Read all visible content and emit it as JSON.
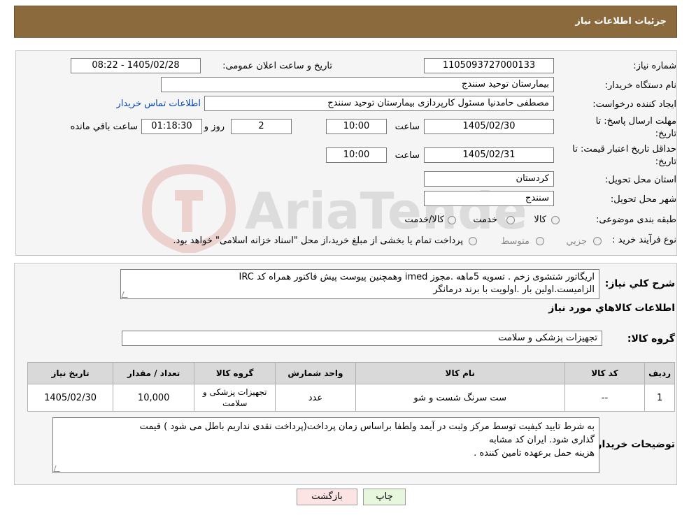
{
  "header": {
    "title": "جزئیات اطلاعات نیاز"
  },
  "form": {
    "need_number_label": "شماره نیاز:",
    "need_number": "1105093727000133",
    "announce_label": "تاریخ و ساعت اعلان عمومی:",
    "announce_value": "1405/02/28 - 08:22",
    "buyer_org_label": "نام دستگاه خریدار:",
    "buyer_org": "بیمارستان توحید سنندج",
    "requester_label": "ایجاد کننده درخواست:",
    "requester": "مصطفی حامدنیا مسئول کارپردازی بیمارستان توحید سنندج",
    "contact_link": "اطلاعات تماس خریدار",
    "deadline_label_1": "مهلت ارسال پاسخ: تا",
    "deadline_label_2": "تاریخ:",
    "deadline_date": "1405/02/30",
    "time_label": "ساعت",
    "deadline_time": "10:00",
    "days_value": "2",
    "days_label": "روز و",
    "remaining_time": "01:18:30",
    "remaining_label": "ساعت باقي مانده",
    "validity_label_1": "حداقل تاریخ اعتبار قیمت: تا",
    "validity_label_2": "تاریخ:",
    "validity_date": "1405/02/31",
    "validity_time": "10:00",
    "province_label": "استان محل تحویل:",
    "province": "کردستان",
    "city_label": "شهر محل تحویل:",
    "city": "سنندج",
    "category_label": "طبقه بندی موضوعی:",
    "category_options": [
      "کالا",
      "خدمت",
      "کالا/خدمت"
    ],
    "process_label": "نوع فرآیند خرید :",
    "process_options": [
      "جزیي",
      "متوسط"
    ],
    "process_note": "پرداخت تمام یا بخشی از مبلغ خرید،از محل \"اسناد خزانه اسلامی\" خواهد بود."
  },
  "watermark": {
    "text": "AriaTender.neT"
  },
  "description": {
    "label": "شرح کلي نياز:",
    "line1": "اریگاتور شتشوی زخم . تسویه 5ماهه .مجوز imed وهمچنین پیوست پیش فاکتور همراه کد IRC",
    "line2": "الزامیست.اولین بار .اولویت با برند درمانگر"
  },
  "goods": {
    "section_title": "اطلاعات کالاهاي مورد نياز",
    "group_label": "گروه کالا:",
    "group_value": "تجهیزات پزشکی و سلامت",
    "columns": [
      "رديف",
      "کد کالا",
      "نام کالا",
      "واحد شمارش",
      "گروه کالا",
      "تعداد / مقدار",
      "تاریخ نیاز"
    ],
    "rows": [
      {
        "index": "1",
        "code": "--",
        "name": "ست سرنگ شست و شو",
        "unit": "عدد",
        "group": "تجهیزات پزشکی و سلامت",
        "quantity": "10,000",
        "date": "1405/02/30"
      }
    ]
  },
  "buyer_notes": {
    "label": "توضیحات خریدار:",
    "line1": "به شرط تایید کیفیت توسط مرکز وثبت در آیمد ولطفا براساس زمان پرداخت(پرداخت نقدی نداریم باطل می شود ) قیمت",
    "line2": "گذاری شود. ایران کد مشابه",
    "line3": "هزینه حمل برعهده تامین کننده ."
  },
  "buttons": {
    "print": "چاپ",
    "back": "بازگشت"
  }
}
